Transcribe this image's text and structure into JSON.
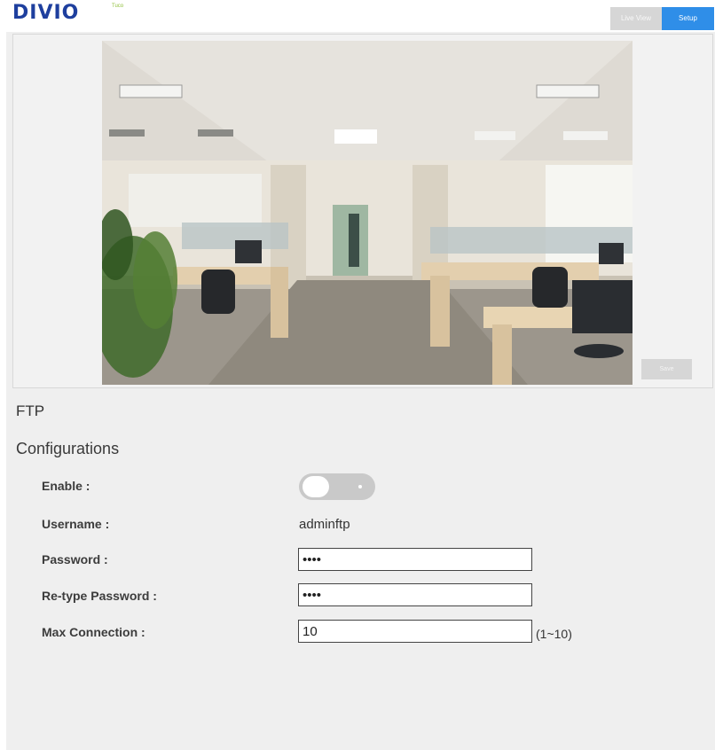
{
  "header": {
    "logo_text": "DIVIO",
    "logo_sup": "Tuco",
    "brand_color": "#1e3f9e",
    "tabs": [
      {
        "label": "Live View",
        "active": false
      },
      {
        "label": "Setup",
        "active": true
      }
    ],
    "accent_color": "#2f8ee8"
  },
  "video": {
    "save_label": "Save"
  },
  "ftp": {
    "section_title": "FTP",
    "sub_title": "Configurations",
    "enable_label": "Enable :",
    "enable_on": false,
    "username_label": "Username :",
    "username_value": "adminftp",
    "password_label": "Password :",
    "password_value": "abcd",
    "retype_label": "Re-type Password :",
    "retype_value": "abcd",
    "max_conn_label": "Max Connection :",
    "max_conn_value": "10",
    "max_conn_hint": "(1~10)"
  }
}
